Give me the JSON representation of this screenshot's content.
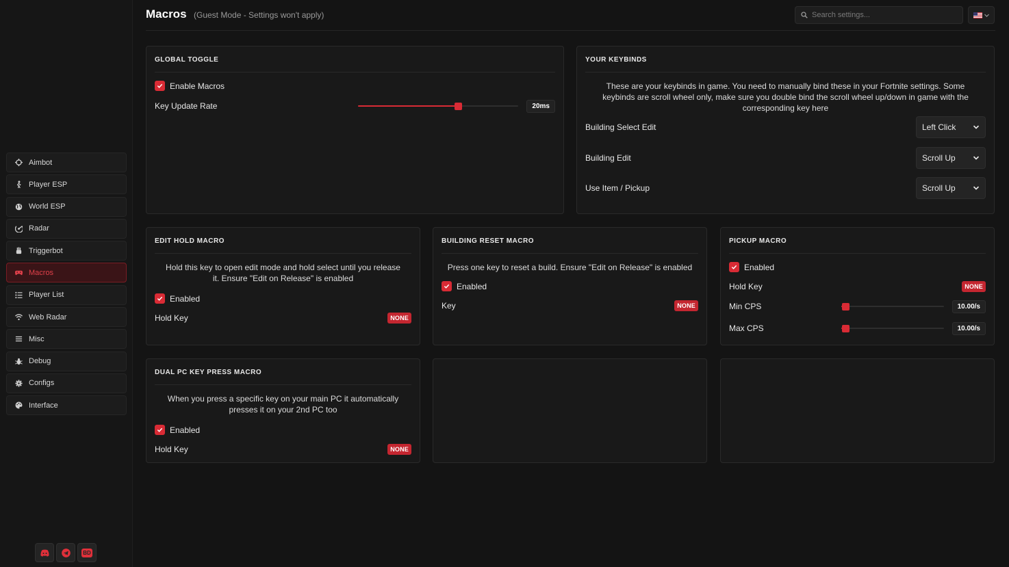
{
  "header": {
    "title": "Macros",
    "subtitle": "(Guest Mode - Settings won't apply)",
    "search_placeholder": "Search settings...",
    "language_flag": "us-flag-icon"
  },
  "sidebar": {
    "items": [
      {
        "label": "Aimbot",
        "icon": "crosshair-icon"
      },
      {
        "label": "Player ESP",
        "icon": "person-icon"
      },
      {
        "label": "World ESP",
        "icon": "globe-icon"
      },
      {
        "label": "Radar",
        "icon": "radar-icon"
      },
      {
        "label": "Triggerbot",
        "icon": "hand-icon"
      },
      {
        "label": "Macros",
        "icon": "gamepad-icon",
        "active": true
      },
      {
        "label": "Player List",
        "icon": "list-icon"
      },
      {
        "label": "Web Radar",
        "icon": "wifi-icon"
      },
      {
        "label": "Misc",
        "icon": "menu-icon"
      },
      {
        "label": "Debug",
        "icon": "bug-icon"
      },
      {
        "label": "Configs",
        "icon": "gear-icon"
      },
      {
        "label": "Interface",
        "icon": "palette-icon"
      }
    ],
    "footer": {
      "discord": "discord-icon",
      "telegram": "telegram-icon",
      "bd_label": "BD"
    }
  },
  "colors": {
    "accent": "#d92b35",
    "active_bg": "#3a1417",
    "bg": "#141414",
    "card": "#191919"
  },
  "global_toggle": {
    "title": "GLOBAL TOGGLE",
    "enable_label": "Enable Macros",
    "enabled": true,
    "rate_label": "Key Update Rate",
    "rate_value": "20ms",
    "rate_fraction": 0.62
  },
  "keybinds": {
    "title": "YOUR KEYBINDS",
    "description": "These are your keybinds in game. You need to manually bind these in your Fortnite settings. Some keybinds are scroll wheel only, make sure you double bind the scroll wheel up/down in game with the corresponding key here",
    "rows": [
      {
        "label": "Building Select Edit",
        "value": "Left Click"
      },
      {
        "label": "Building Edit",
        "value": "Scroll Up"
      },
      {
        "label": "Use Item / Pickup",
        "value": "Scroll Up"
      }
    ]
  },
  "edit_hold": {
    "title": "EDIT HOLD MACRO",
    "description": "Hold this key to open edit mode and hold select until you release it. Ensure \"Edit on Release\" is enabled",
    "enabled_label": "Enabled",
    "key_label": "Hold Key",
    "key_value": "NONE"
  },
  "building_reset": {
    "title": "BUILDING RESET MACRO",
    "description": "Press one key to reset a build. Ensure \"Edit on Release\" is enabled",
    "enabled_label": "Enabled",
    "key_label": "Key",
    "key_value": "NONE"
  },
  "pickup": {
    "title": "PICKUP MACRO",
    "enabled_label": "Enabled",
    "key_label": "Hold Key",
    "key_value": "NONE",
    "min_label": "Min CPS",
    "min_value": "10.00/s",
    "min_fraction": 0.04,
    "max_label": "Max CPS",
    "max_value": "10.00/s",
    "max_fraction": 0.04
  },
  "dual_pc": {
    "title": "DUAL PC KEY PRESS MACRO",
    "description": "When you press a specific key on your main PC it automatically presses it on your 2nd PC too",
    "enabled_label": "Enabled",
    "key_label": "Hold Key",
    "key_value": "NONE"
  }
}
